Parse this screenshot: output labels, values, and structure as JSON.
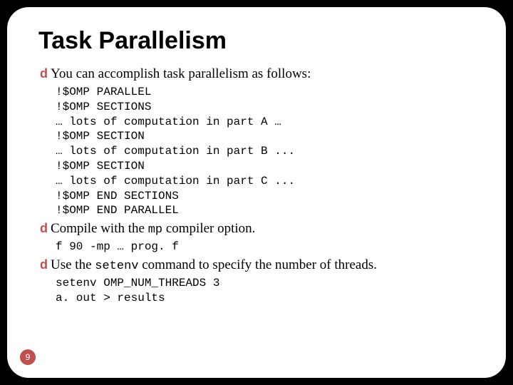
{
  "title": "Task Parallelism",
  "bullets": {
    "b1": "You can accomplish task parallelism as follows:",
    "b2_pre": "Compile with the ",
    "b2_mid": "mp",
    "b2_post": " compiler option.",
    "b3_pre": "Use the ",
    "b3_mid": "setenv",
    "b3_post": " command to specify the number of threads."
  },
  "code1": "!$OMP PARALLEL\n!$OMP SECTIONS\n… lots of computation in part A …\n!$OMP SECTION\n… lots of computation in part B ...\n!$OMP SECTION\n… lots of computation in part C ...\n!$OMP END SECTIONS\n!$OMP END PARALLEL",
  "code2": "f 90 -mp … prog. f",
  "code3": "setenv OMP_NUM_THREADS 3\na. out > results",
  "bullet_glyph": "d",
  "page_number": "9"
}
